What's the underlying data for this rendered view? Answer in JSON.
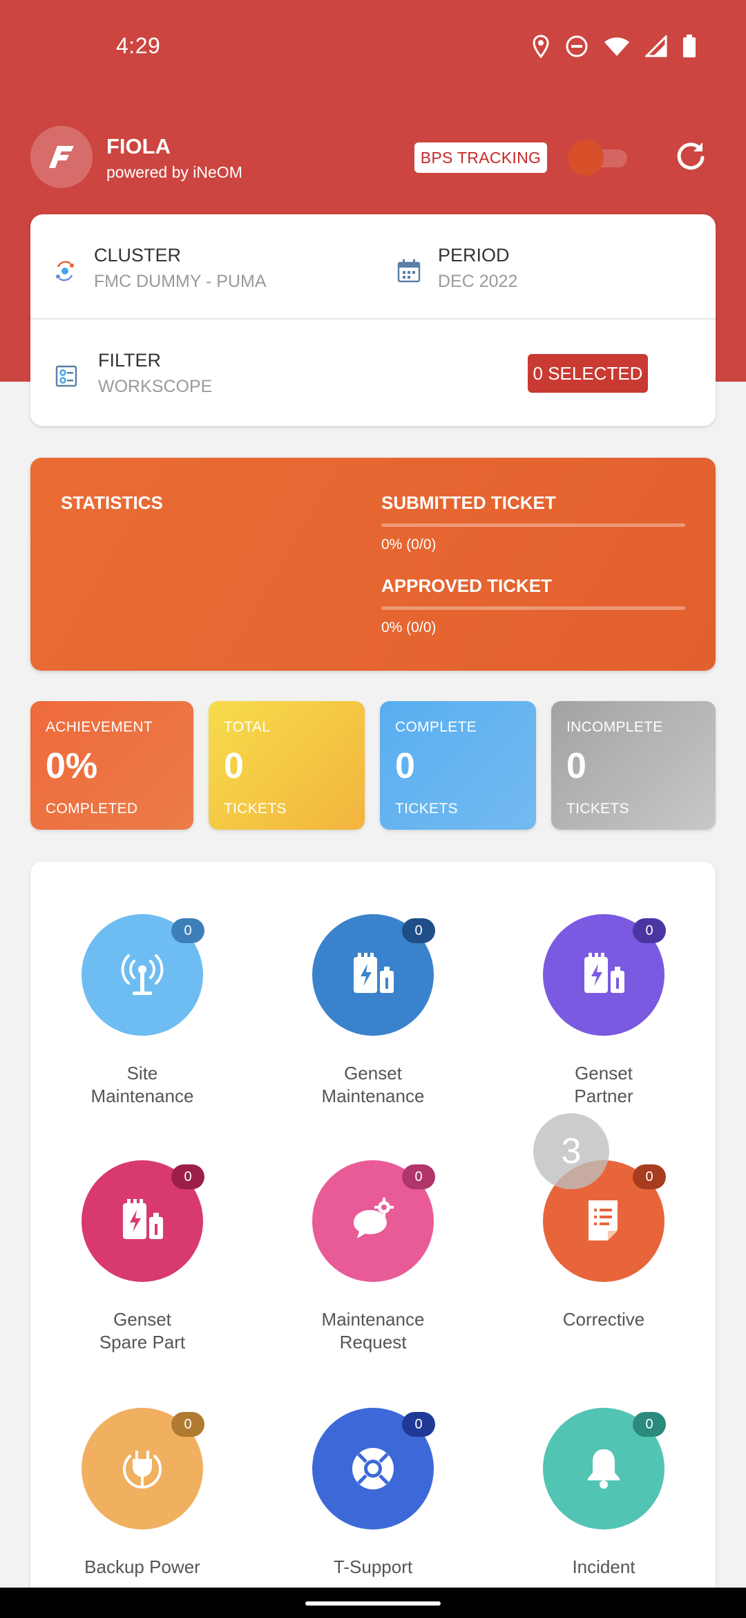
{
  "status_bar": {
    "time": "4:29"
  },
  "header": {
    "brand_initial": "F",
    "brand_name": "FIOLA",
    "brand_sub": "powered by iNeOM",
    "bps_label": "BPS TRACKING",
    "bps_tracking_on": false
  },
  "info": {
    "cluster_title": "CLUSTER",
    "cluster_value": "FMC DUMMY - PUMA",
    "period_title": "PERIOD",
    "period_value": "DEC 2022",
    "filter_title": "FILTER",
    "filter_value": "WORKSCOPE",
    "selected_label": "0 SELECTED"
  },
  "statistics": {
    "title": "STATISTICS",
    "submitted_label": "SUBMITTED TICKET",
    "submitted_value": "0% (0/0)",
    "submitted_fraction": 0,
    "approved_label": "APPROVED TICKET",
    "approved_value": "0% (0/0)",
    "approved_fraction": 0
  },
  "tiles": [
    {
      "top": "ACHIEVEMENT",
      "num": "0%",
      "bottom": "COMPLETED"
    },
    {
      "top": "TOTAL",
      "num": "0",
      "bottom": "TICKETS"
    },
    {
      "top": "COMPLETE",
      "num": "0",
      "bottom": "TICKETS"
    },
    {
      "top": "INCOMPLETE",
      "num": "0",
      "bottom": "TICKETS"
    }
  ],
  "menu": [
    {
      "line1": "Site",
      "line2": "Maintenance",
      "badge": "0",
      "icon": "antenna-icon",
      "color": "#6dbdf2",
      "badge_color": "#3d7fb8"
    },
    {
      "line1": "Genset",
      "line2": "Maintenance",
      "badge": "0",
      "icon": "generator-icon",
      "color": "#3a83cc",
      "badge_color": "#1f4f86"
    },
    {
      "line1": "Genset",
      "line2": "Partner",
      "badge": "0",
      "icon": "generator-icon",
      "color": "#7a5ae0",
      "badge_color": "#4a35a2"
    },
    {
      "line1": "Genset",
      "line2": "Spare Part",
      "badge": "0",
      "icon": "generator-icon",
      "color": "#d83a6e",
      "badge_color": "#9c1f48"
    },
    {
      "line1": "Maintenance",
      "line2": "Request",
      "badge": "0",
      "icon": "chat-gear-icon",
      "color": "#e85b97",
      "badge_color": "#b0356a"
    },
    {
      "line1": "Corrective",
      "line2": "",
      "badge": "0",
      "icon": "document-list-icon",
      "color": "#e8643a",
      "badge_color": "#a83c1e"
    },
    {
      "line1": "Backup Power",
      "line2": "",
      "badge": "0",
      "icon": "plug-icon",
      "color": "#f0b060",
      "badge_color": "#b07a30"
    },
    {
      "line1": "T-Support",
      "line2": "",
      "badge": "0",
      "icon": "lifebuoy-icon",
      "color": "#3d68d8",
      "badge_color": "#1f3a96"
    },
    {
      "line1": "Incident",
      "line2": "",
      "badge": "0",
      "icon": "bell-icon",
      "color": "#52c4b4",
      "badge_color": "#2a8a7c"
    }
  ],
  "touch_indicator": "3"
}
